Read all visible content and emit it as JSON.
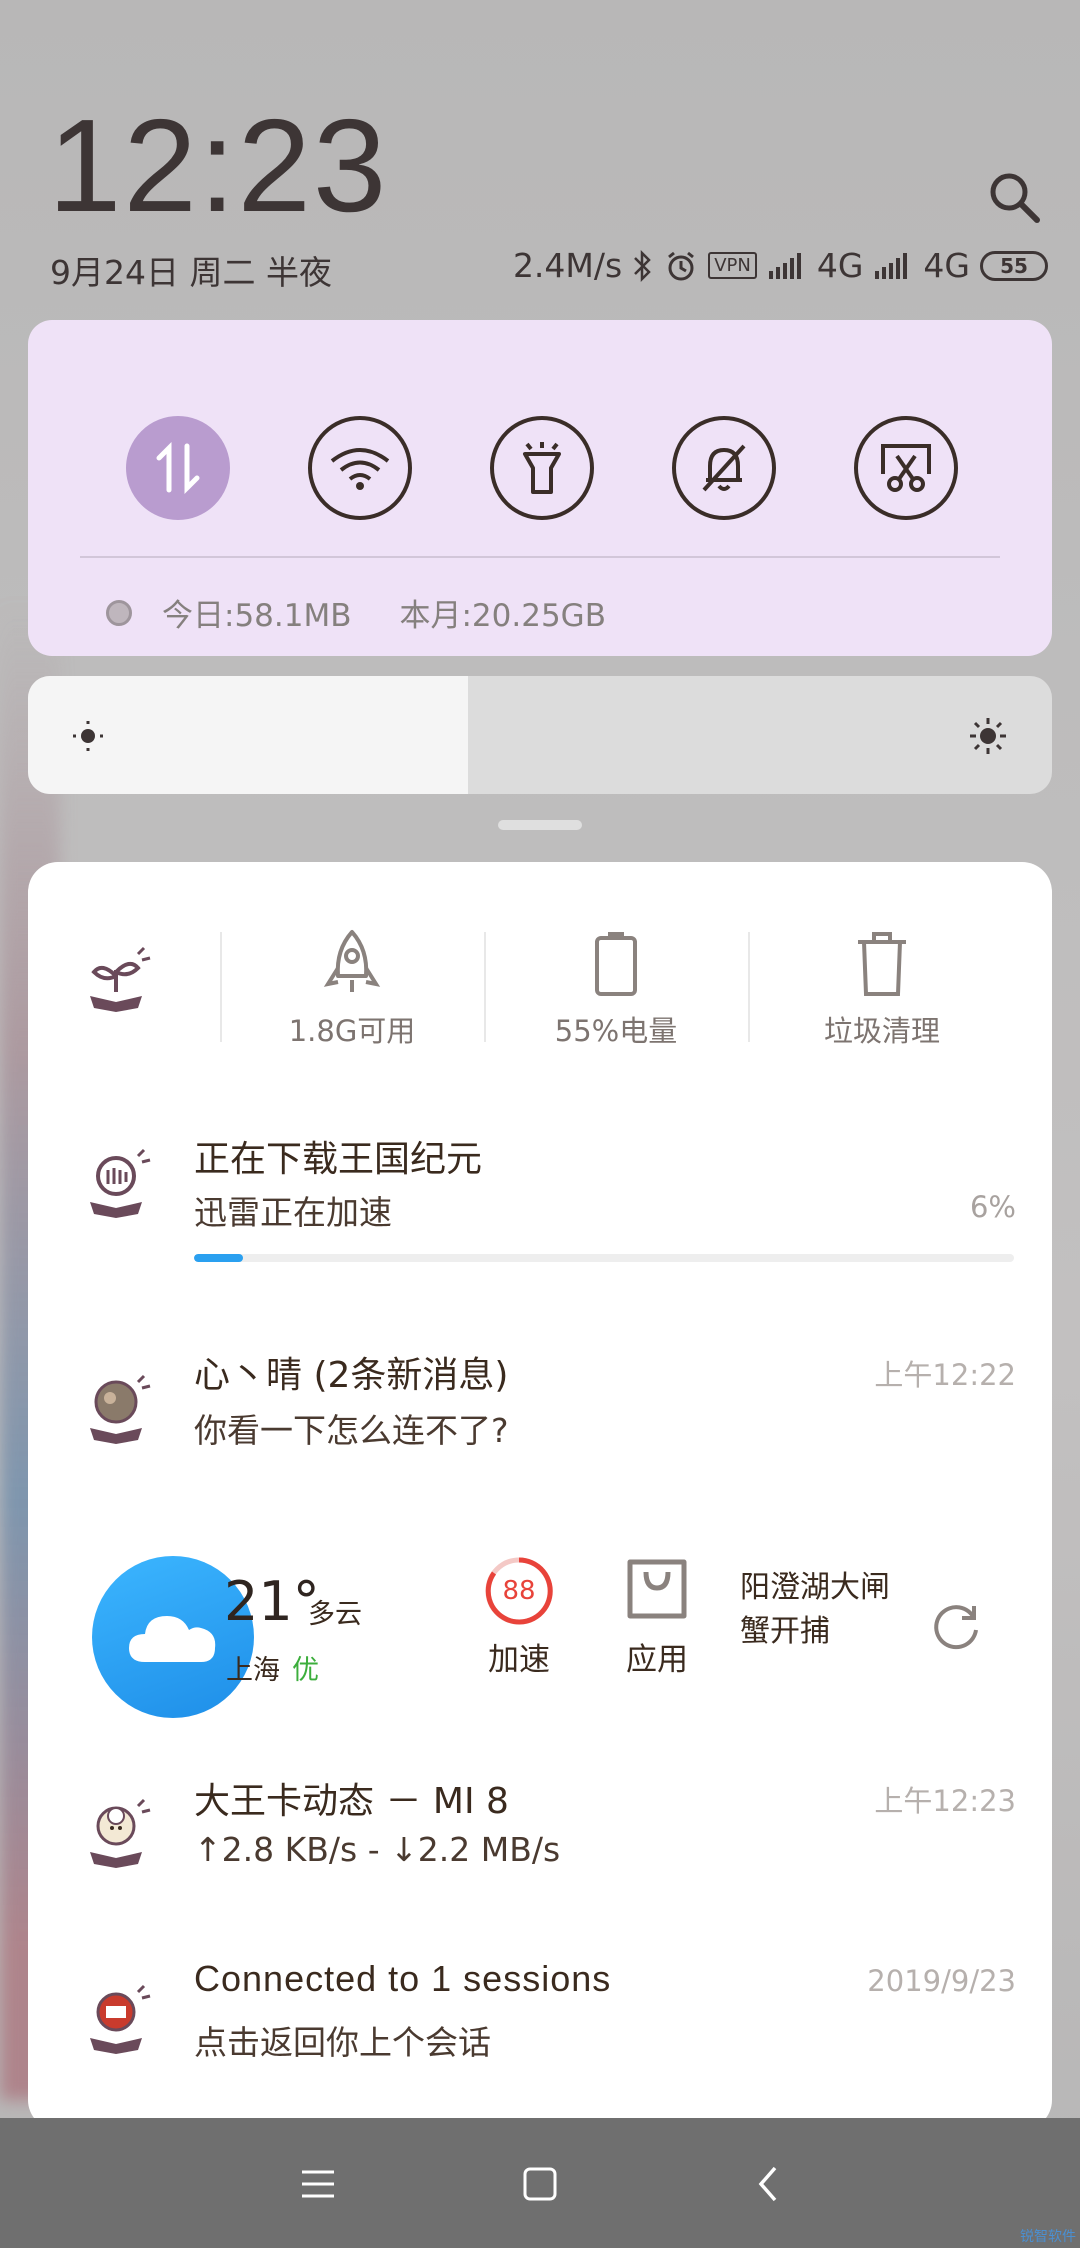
{
  "lockscreen": {
    "time": "12:23",
    "date": "9月24日 周二 半夜",
    "status": {
      "net_speed": "2.4M/s",
      "vpn": "VPN",
      "sim1": "4G",
      "sim2": "4G",
      "battery": "55"
    }
  },
  "quick_settings": {
    "toggles": [
      {
        "name": "mobile-data",
        "active": true
      },
      {
        "name": "wifi",
        "active": false
      },
      {
        "name": "flashlight",
        "active": false
      },
      {
        "name": "silent",
        "active": false
      },
      {
        "name": "screenshot",
        "active": false
      }
    ],
    "usage_today": "今日:58.1MB",
    "usage_month": "本月:20.25GB"
  },
  "brightness": {
    "level": 0.43
  },
  "tools": {
    "memory": "1.8G可用",
    "battery": "55%电量",
    "cleanup": "垃圾清理"
  },
  "notifications": {
    "download": {
      "title": "正在下载王国纪元",
      "text": "迅雷正在加速",
      "percent": "6%",
      "progress": 0.06
    },
    "message": {
      "title": "心丶晴 (2条新消息)",
      "text": "你看一下怎么连不了?",
      "time": "上午12:22"
    },
    "weather": {
      "temp": "21°",
      "desc": "多云",
      "city": "上海",
      "aqi": "优",
      "boost_value": "88",
      "boost_label": "加速",
      "apps_label": "应用",
      "news_line1": "阳澄湖大闸",
      "news_line2": "蟹开捕"
    },
    "traffic": {
      "title": "大王卡动态 － MI 8",
      "text": "↑2.8 KB/s - ↓2.2 MB/s",
      "time": "上午12:23"
    },
    "session": {
      "title": "Connected to 1 sessions",
      "text": "点击返回你上个会话",
      "time": "2019/9/23"
    }
  },
  "colors": {
    "qs_background": "#efe2f7",
    "toggle_active": "#b99ccf",
    "progress": "#2aa0f0",
    "weather_blue": "#1e8ee8",
    "aqi_green": "#3cae3c",
    "boost_red": "#e8433a"
  },
  "watermark": "锐智软件"
}
